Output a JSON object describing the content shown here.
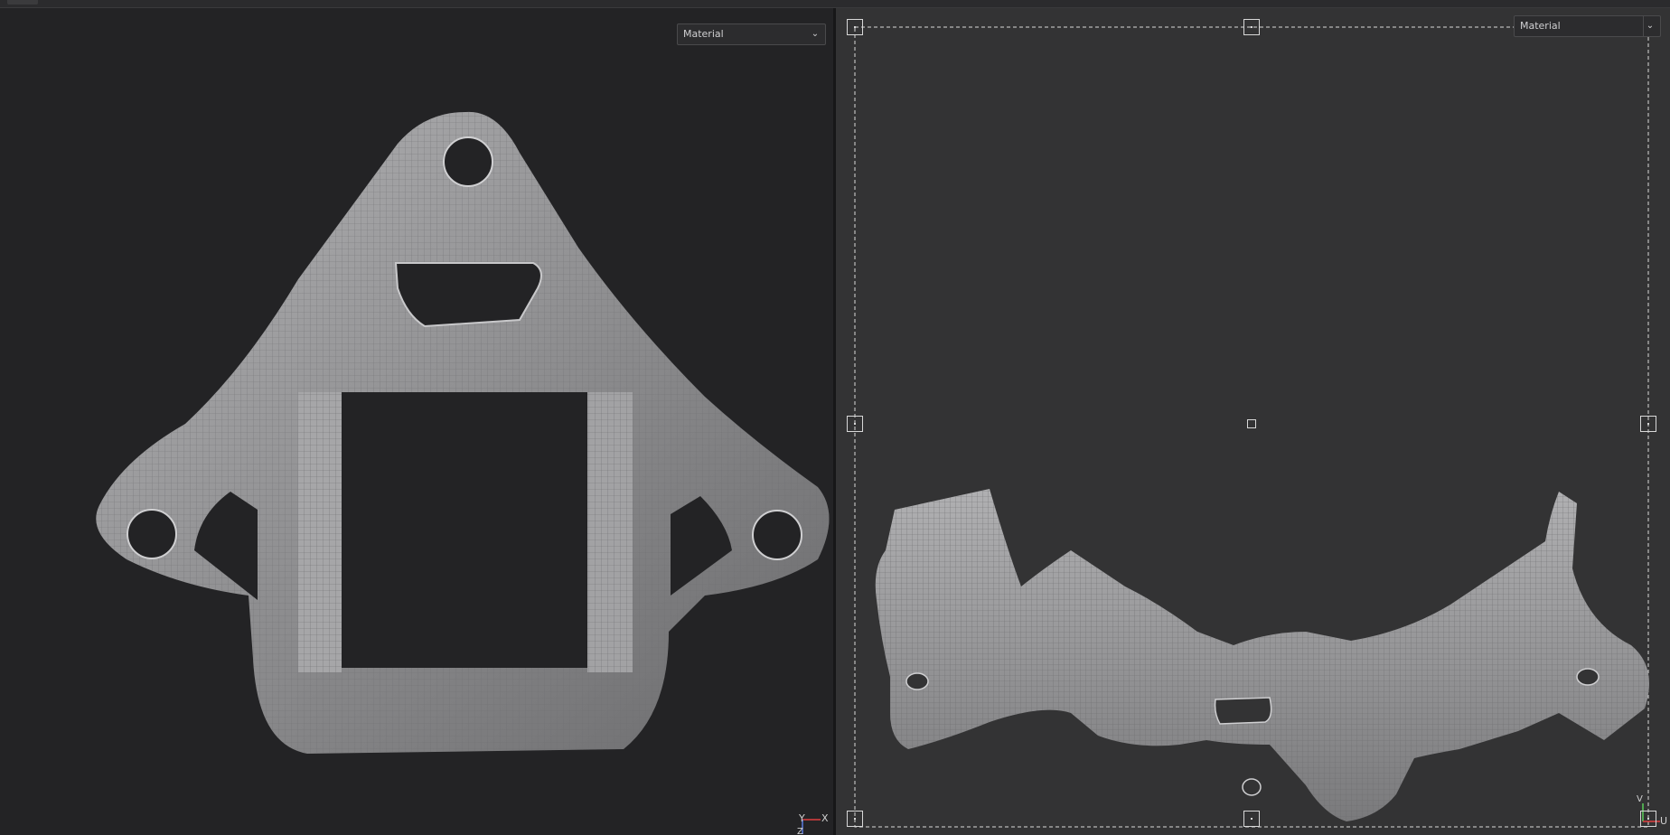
{
  "viewports": {
    "left": {
      "shading_mode": "Material"
    },
    "right": {
      "shading_mode": "Material"
    }
  },
  "axes": {
    "left": {
      "x_label": "X",
      "y_label": "Y",
      "z_label": "Z"
    },
    "right": {
      "u_label": "U",
      "v_label": "V"
    }
  },
  "icons": {
    "dropdown_chevron": "chevron-down-icon",
    "transform_handle": "square-handle-icon"
  },
  "colors": {
    "viewport_3d_bg": "#232325",
    "viewport_uv_bg": "#333334",
    "mesh_gray": "#8e8e90",
    "axis_x": "#e04040",
    "axis_y": "#5ad05a",
    "axis_z": "#5a7ae0"
  }
}
